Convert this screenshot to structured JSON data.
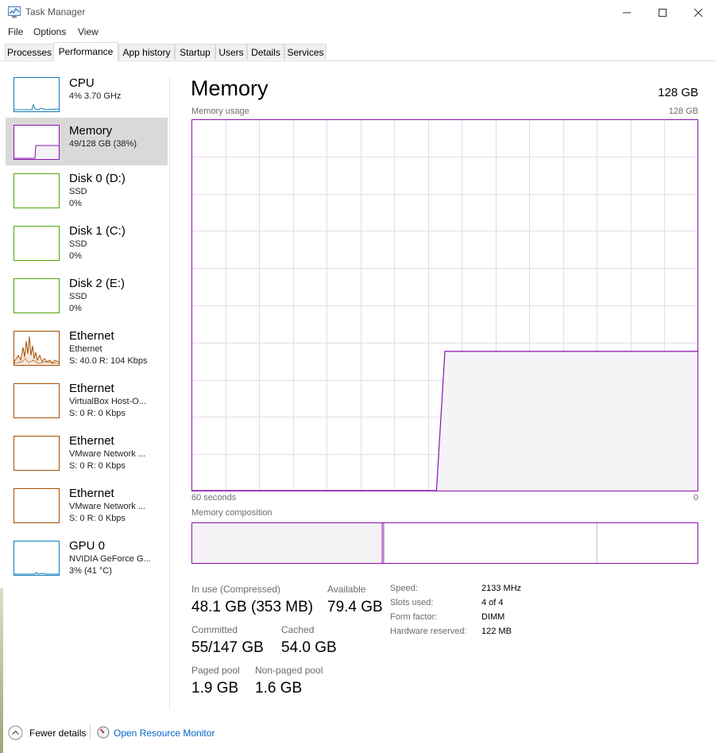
{
  "window": {
    "title": "Task Manager"
  },
  "menu": [
    "File",
    "Options",
    "View"
  ],
  "tabs": [
    "Processes",
    "Performance",
    "App history",
    "Startup",
    "Users",
    "Details",
    "Services"
  ],
  "active_tab": "Performance",
  "sidebar": [
    {
      "title": "CPU",
      "line1": "4% 3.70 GHz",
      "line2": "",
      "color": "#117dbb"
    },
    {
      "title": "Memory",
      "line1": "49/128 GB (38%)",
      "line2": "",
      "color": "#8b12ae"
    },
    {
      "title": "Disk 0 (D:)",
      "line1": "SSD",
      "line2": "0%",
      "color": "#4da60c"
    },
    {
      "title": "Disk 1 (C:)",
      "line1": "SSD",
      "line2": "0%",
      "color": "#4da60c"
    },
    {
      "title": "Disk 2 (E:)",
      "line1": "SSD",
      "line2": "0%",
      "color": "#4da60c"
    },
    {
      "title": "Ethernet",
      "line1": "Ethernet",
      "line2": "S: 40.0  R: 104 Kbps",
      "color": "#a74f01"
    },
    {
      "title": "Ethernet",
      "line1": "VirtualBox Host-O...",
      "line2": "S: 0  R: 0 Kbps",
      "color": "#a74f01"
    },
    {
      "title": "Ethernet",
      "line1": "VMware Network ...",
      "line2": "S: 0  R: 0 Kbps",
      "color": "#a74f01"
    },
    {
      "title": "Ethernet",
      "line1": "VMware Network ...",
      "line2": "S: 0  R: 0 Kbps",
      "color": "#a74f01"
    },
    {
      "title": "GPU 0",
      "line1": "NVIDIA GeForce G...",
      "line2": "3% (41 °C)",
      "color": "#117dbb"
    }
  ],
  "main": {
    "title": "Memory",
    "total": "128 GB",
    "usage_label": "Memory usage",
    "usage_max": "128 GB",
    "time_left": "60 seconds",
    "time_right": "0",
    "composition_label": "Memory composition"
  },
  "chart_data": {
    "type": "area",
    "x": [
      60,
      31,
      30,
      0
    ],
    "values": [
      0,
      0,
      48.1,
      48.1
    ],
    "xlim": [
      60,
      0
    ],
    "ylim": [
      0,
      128
    ],
    "xlabel": "",
    "ylabel": "",
    "title": "",
    "grid": true,
    "color": "#8b12ae"
  },
  "composition": {
    "in_use": 48.1,
    "modified": 0.2,
    "standby": 54.0,
    "free": 25.7,
    "total": 128
  },
  "stats": {
    "in_use_label": "In use (Compressed)",
    "in_use_value": "48.1 GB (353 MB)",
    "available_label": "Available",
    "available_value": "79.4 GB",
    "committed_label": "Committed",
    "committed_value": "55/147 GB",
    "cached_label": "Cached",
    "cached_value": "54.0 GB",
    "paged_label": "Paged pool",
    "paged_value": "1.9 GB",
    "nonpaged_label": "Non-paged pool",
    "nonpaged_value": "1.6 GB"
  },
  "specs": [
    {
      "label": "Speed:",
      "value": "2133 MHz"
    },
    {
      "label": "Slots used:",
      "value": "4 of 4"
    },
    {
      "label": "Form factor:",
      "value": "DIMM"
    },
    {
      "label": "Hardware reserved:",
      "value": "122 MB"
    }
  ],
  "footer": {
    "fewer_details": "Fewer details",
    "resource_monitor": "Open Resource Monitor"
  },
  "colors": {
    "memory": "#8b12ae",
    "memory_fill": "#f4f2f4",
    "link": "#0066cc",
    "grid": "#e5dcea"
  }
}
